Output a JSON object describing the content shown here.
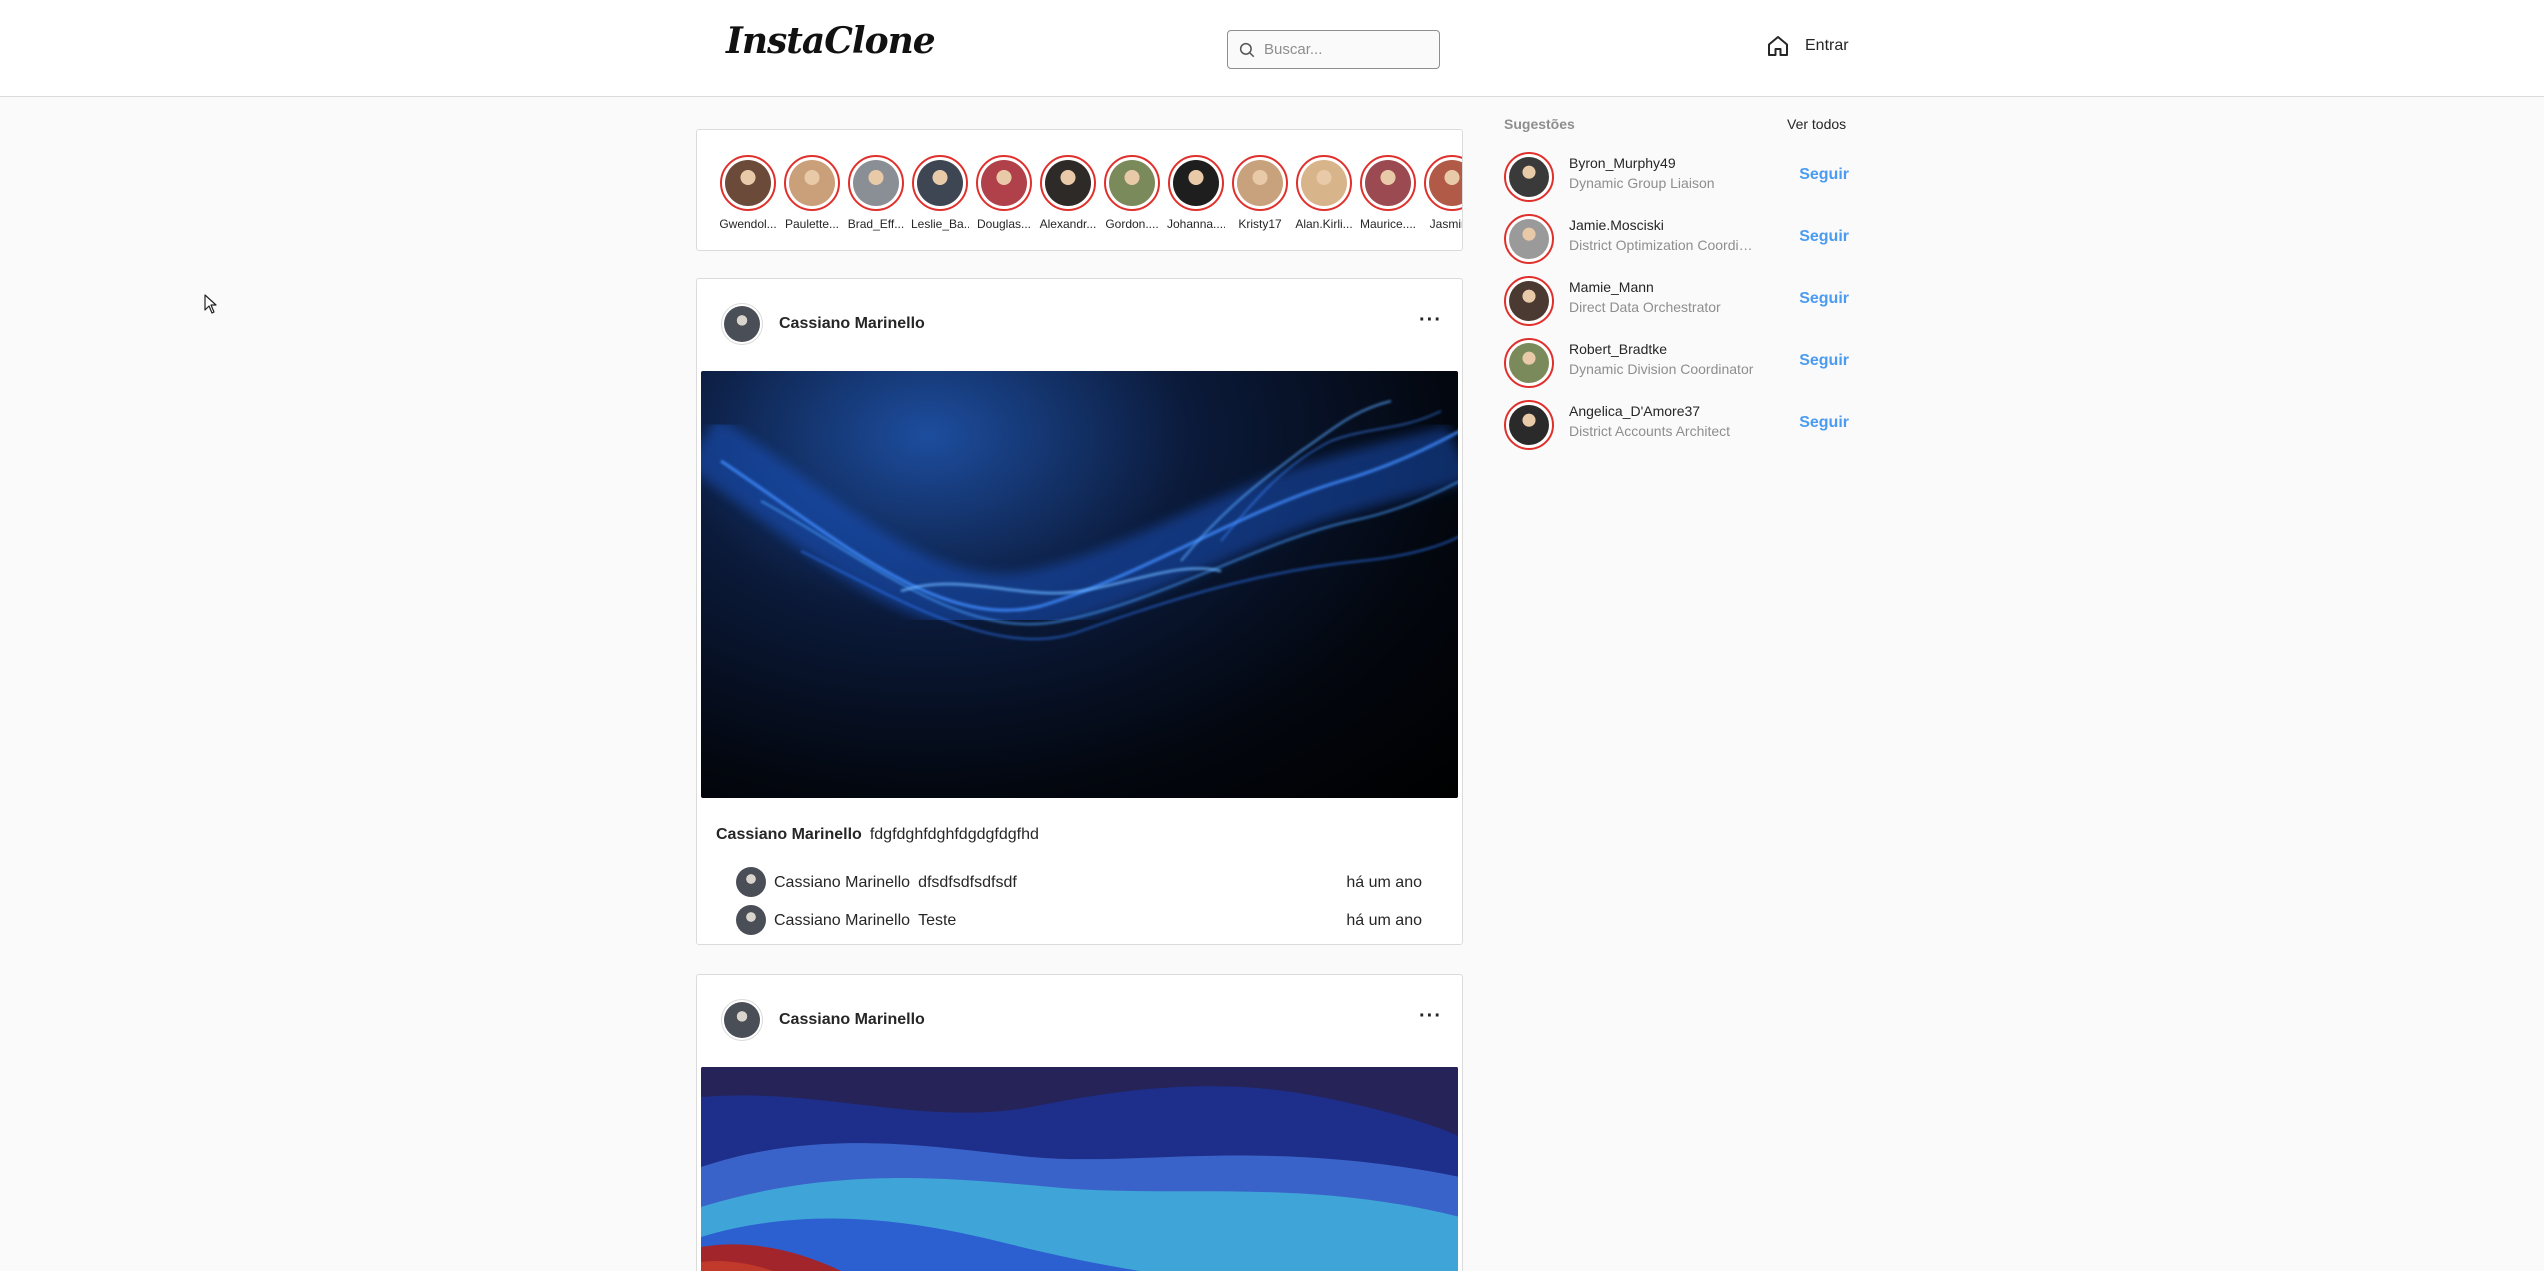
{
  "header": {
    "logo": "InstaClone",
    "search_placeholder": "Buscar...",
    "login_label": "Entrar"
  },
  "stories": [
    {
      "name": "Gwendol...",
      "color": "#6b4a3a"
    },
    {
      "name": "Paulette...",
      "color": "#c9a07a"
    },
    {
      "name": "Brad_Eff...",
      "color": "#8a8f96"
    },
    {
      "name": "Leslie_Ba...",
      "color": "#3d4652"
    },
    {
      "name": "Douglas...",
      "color": "#b0404a"
    },
    {
      "name": "Alexandr...",
      "color": "#2e2a28"
    },
    {
      "name": "Gordon....",
      "color": "#7a8a5a"
    },
    {
      "name": "Johanna....",
      "color": "#1e1e1e"
    },
    {
      "name": "Kristy17",
      "color": "#c7a27c"
    },
    {
      "name": "Alan.Kirli...",
      "color": "#d8b48a"
    },
    {
      "name": "Maurice....",
      "color": "#9a4a50"
    },
    {
      "name": "Jasmine",
      "color": "#b25a48"
    }
  ],
  "posts": [
    {
      "author": "Cassiano Marinello",
      "caption": "fdgfdghfdghfdgdgfdgfhd",
      "comments": [
        {
          "author": "Cassiano Marinello",
          "text": "dfsdfsdfsdfsdf",
          "time": "há um ano"
        },
        {
          "author": "Cassiano Marinello",
          "text": "Teste",
          "time": "há um ano"
        }
      ]
    },
    {
      "author": "Cassiano Marinello"
    }
  ],
  "suggestions": {
    "title": "Sugestões",
    "see_all": "Ver todos",
    "follow_label": "Seguir",
    "users": [
      {
        "username": "Byron_Murphy49",
        "desc": "Dynamic Group Liaison",
        "color": "#3a3a3a"
      },
      {
        "username": "Jamie.Mosciski",
        "desc": "District Optimization Coordinator",
        "color": "#9a9a9a"
      },
      {
        "username": "Mamie_Mann",
        "desc": "Direct Data Orchestrator",
        "color": "#4a3a32"
      },
      {
        "username": "Robert_Bradtke",
        "desc": "Dynamic Division Coordinator",
        "color": "#7a8a5a"
      },
      {
        "username": "Angelica_D'Amore37",
        "desc": "District Accounts Architect",
        "color": "#2a2a2a"
      }
    ]
  },
  "colors": {
    "accent": "#4b9bf0",
    "story_ring": "#e0302c"
  }
}
